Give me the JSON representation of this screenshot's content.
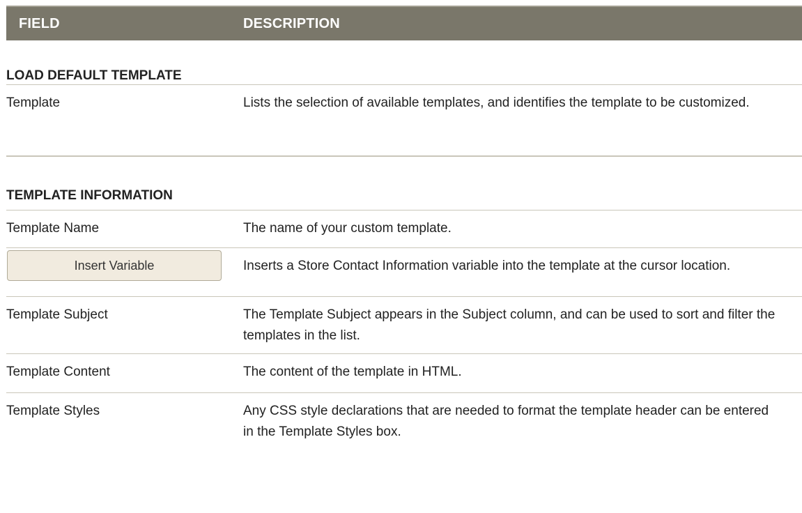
{
  "header": {
    "field": "FIELD",
    "description": "DESCRIPTION"
  },
  "sections": [
    {
      "title": "LOAD DEFAULT TEMPLATE",
      "rows": [
        {
          "field": "Template",
          "description": "Lists the selection of available templates, and identifies the template to be customized."
        }
      ]
    },
    {
      "title": "TEMPLATE INFORMATION",
      "rows": [
        {
          "field": "Template Name",
          "description": "The name of your custom template."
        },
        {
          "field_button": "Insert Variable",
          "description": "Inserts a Store Contact Information variable into the template at the cursor location."
        },
        {
          "field": "Template Subject",
          "description": "The Template Subject appears in the Subject column, and can be used to sort and filter the templates in the list."
        },
        {
          "field": "Template Content",
          "description": "The content of the template in HTML."
        },
        {
          "field": "Template Styles",
          "description": "Any CSS style declarations that are needed to format the template header can be entered in the Template Styles box."
        }
      ]
    }
  ],
  "colors": {
    "header_background": "#7a776a",
    "header_text": "#ffffff",
    "row_divider": "#c9c6b9",
    "button_background": "#f1ebdf",
    "button_border": "#b0aa97"
  }
}
